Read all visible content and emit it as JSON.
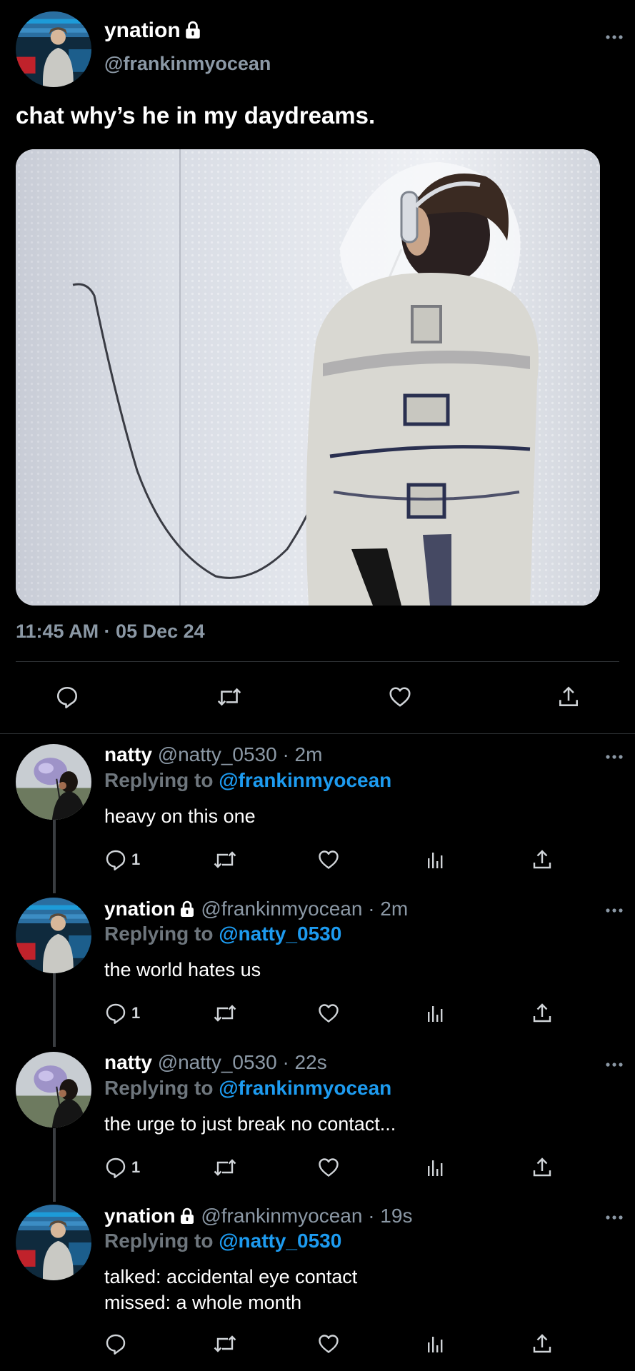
{
  "main_tweet": {
    "name": "ynation",
    "handle": "@frankinmyocean",
    "text": "chat why’s he in my daydreams.",
    "timestamp": "11:45 AM · 05 Dec 24",
    "media_description_icon": "photo",
    "lock_icon": "lock-icon"
  },
  "action_icons": [
    "reply-icon",
    "retweet-icon",
    "like-icon",
    "share-icon"
  ],
  "replies": [
    {
      "name": "natty",
      "meta": "@natty_0530 · 2m",
      "replying_prefix": "Replying to",
      "mention": "@frankinmyocean",
      "text_lines": [
        "heavy on this one"
      ],
      "reply_count": "1",
      "locked": false
    },
    {
      "name": "ynation",
      "meta": "@frankinmyocean · 2m",
      "replying_prefix": "Replying to",
      "mention": "@natty_0530",
      "text_lines": [
        "the world hates us"
      ],
      "reply_count": "1",
      "locked": true
    },
    {
      "name": "natty",
      "meta": "@natty_0530 · 22s",
      "replying_prefix": "Replying to",
      "mention": "@frankinmyocean",
      "text_lines": [
        "the urge to just break no contact..."
      ],
      "reply_count": "1",
      "locked": false
    },
    {
      "name": "ynation",
      "meta": "@frankinmyocean · 19s",
      "replying_prefix": "Replying to",
      "mention": "@natty_0530",
      "text_lines": [
        "talked: accidental eye contact",
        "missed: a whole month"
      ],
      "reply_count": "",
      "locked": true
    }
  ],
  "colors": {
    "background": "#000000",
    "link": "#1d9bf0",
    "secondary_text": "#8b98a5",
    "divider": "#2f3336"
  }
}
